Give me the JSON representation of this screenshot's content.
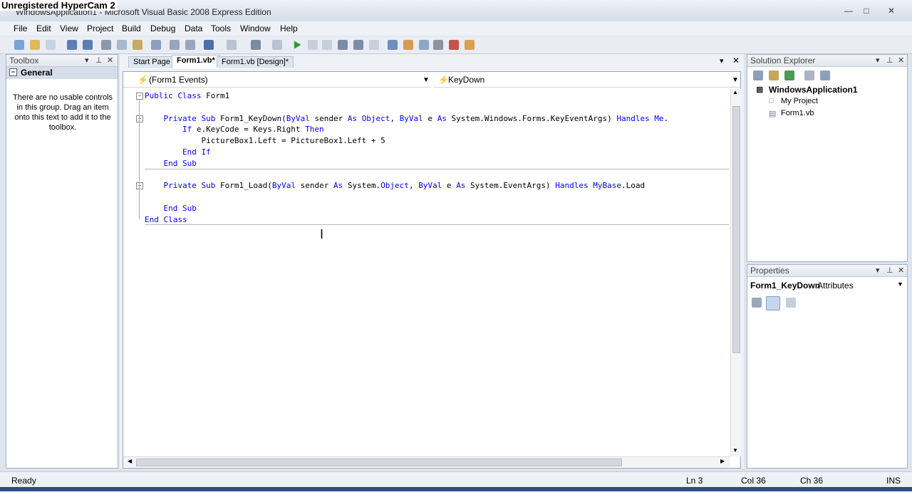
{
  "watermark": "Unregistered HyperCam 2",
  "window": {
    "title": "WindowsApplication1 - Microsoft Visual Basic 2008 Express Edition"
  },
  "menu": [
    "File",
    "Edit",
    "View",
    "Project",
    "Build",
    "Debug",
    "Data",
    "Tools",
    "Window",
    "Help"
  ],
  "toolbox": {
    "title": "Toolbox",
    "group": "General",
    "message": "There are no usable controls in this group. Drag an item onto this text to add it to the toolbox."
  },
  "tabs": [
    {
      "label": "Start Page"
    },
    {
      "label": "Form1.vb*"
    },
    {
      "label": "Form1.vb [Design]*"
    }
  ],
  "editor": {
    "left_combo": "(Form1 Events)",
    "right_combo": "KeyDown",
    "lines": [
      "Public Class Form1",
      "",
      "    Private Sub Form1_KeyDown(ByVal sender As Object, ByVal e As System.Windows.Forms.KeyEventArgs) Handles Me.",
      "        If e.KeyCode = Keys.Right Then",
      "            PictureBox1.Left = PictureBox1.Left + 5",
      "        End If",
      "    End Sub",
      "",
      "    Private Sub Form1_Load(ByVal sender As System.Object, ByVal e As System.EventArgs) Handles MyBase.Load",
      "",
      "    End Sub",
      "End Class"
    ]
  },
  "solution_explorer": {
    "title": "Solution Explorer",
    "project": "WindowsApplication1",
    "items": [
      "My Project",
      "Form1.vb"
    ]
  },
  "properties": {
    "title": "Properties",
    "object": "Form1_KeyDown",
    "object_type": "Attributes"
  },
  "status": {
    "ready": "Ready",
    "ln": "Ln 3",
    "col": "Col 36",
    "ch": "Ch 36",
    "ins": "INS"
  },
  "colors": {
    "keyword": "#0000ff",
    "accent": "#2b4f7e"
  }
}
